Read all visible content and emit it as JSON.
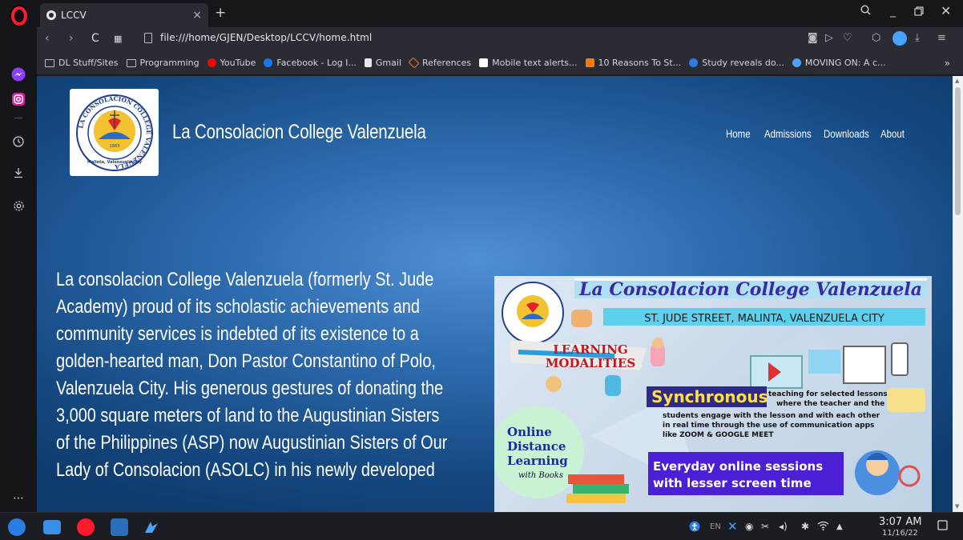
{
  "browser": {
    "tab_title": "LCCV",
    "url": "file:///home/GJEN/Desktop/LCCV/home.html",
    "bookmarks": [
      {
        "label": "DL Stuff/Sites",
        "icon": "folder-icon",
        "color": "#bbbbbb"
      },
      {
        "label": "Programming",
        "icon": "folder-icon",
        "color": "#bbbbbb"
      },
      {
        "label": "YouTube",
        "icon": "youtube-icon",
        "color": "#ff0000"
      },
      {
        "label": "Facebook - Log I...",
        "icon": "facebook-icon",
        "color": "#1877f2"
      },
      {
        "label": "Gmail",
        "icon": "file-icon",
        "color": "#e8e8ea"
      },
      {
        "label": "References",
        "icon": "stack-icon",
        "color": "#f48024"
      },
      {
        "label": "Mobile text alerts...",
        "icon": "wikipedia-icon",
        "color": "#ffffff"
      },
      {
        "label": "10 Reasons To St...",
        "icon": "check-icon",
        "color": "#ff7a00"
      },
      {
        "label": "Study reveals do...",
        "icon": "news-icon",
        "color": "#2f7de1"
      },
      {
        "label": "MOVING ON: A c...",
        "icon": "diamond-icon",
        "color": "#4aa3ff"
      }
    ]
  },
  "site": {
    "title": "La Consolacion College Valenzuela",
    "nav": [
      "Home",
      "Admissions",
      "Downloads",
      "About"
    ],
    "logo_ring_text": "LA CONSOLACION COLLEGE VALENZUELA",
    "logo_year": "1983",
    "logo_place": "Malinta, Valenzuela City",
    "intro_lines": [
      "La consolacion College Valenzuela (formerly St. Jude",
      "Academy) proud of its scholastic achievements and",
      "community services is indebted of its existence to a",
      "golden-hearted man, Don Pastor Constantino of Polo,",
      "Valenzuela City. His generous gestures of donating the",
      "3,000 square meters of land to the Augustinian Sisters",
      "of the Philippines (ASP) now Augustinian Sisters of Our",
      "Lady of Consolacion (ASOLC) in his newly developed"
    ],
    "banner": {
      "heading": "La Consolacion College Valenzuela",
      "address": "ST. JUDE STREET, MALINTA, VALENZUELA CITY",
      "modalities_1": "LEARNING",
      "modalities_2": "MODALITIES",
      "sync_title": "Synchronous",
      "sync_text_1": "teaching for selected lessons",
      "sync_text_2": "where the teacher and the",
      "sync_text_3": "students engage with the lesson and with each other",
      "sync_text_4": "in real time through the use of communication apps",
      "sync_text_5": "like ZOOM & GOOGLE MEET",
      "odl_1": "Online",
      "odl_2": "Distance",
      "odl_3": "Learning",
      "odl_4": "with Books",
      "everyday_1": "Everyday online sessions",
      "everyday_2": "with lesser screen time"
    }
  },
  "taskbar": {
    "time": "3:07 AM",
    "date": "11/16/22",
    "lang": "EN"
  },
  "colors": {
    "opera_red": "#ff1b2d",
    "page_blue": "#2f6db1",
    "banner_purple": "#4b1fd6"
  }
}
